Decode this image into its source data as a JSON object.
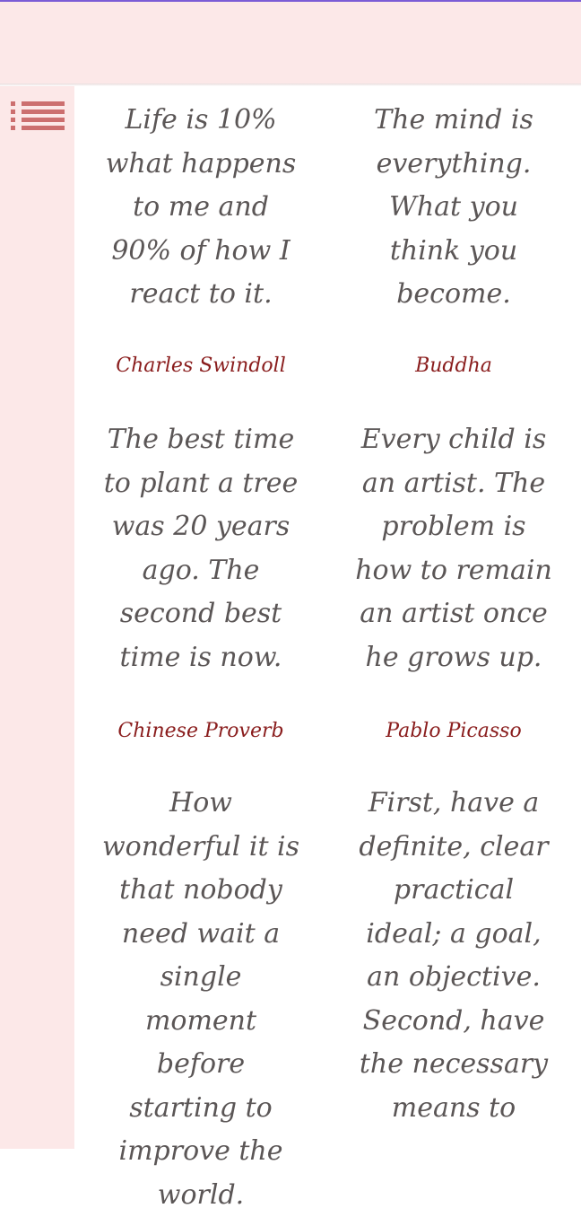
{
  "menu": {
    "icon": "list-icon"
  },
  "quotes": [
    {
      "text": "Life is 10% what happens to me and 90% of how I react to it.",
      "author": "Charles Swindoll"
    },
    {
      "text": "The mind is everything. What you think you become.",
      "author": "Buddha"
    },
    {
      "text": "The best time to plant a tree was 20 years ago. The second best time is now.",
      "author": "Chinese Proverb"
    },
    {
      "text": "Every child is an artist.  The problem is how to remain an artist once he grows up.",
      "author": "Pablo Picasso"
    },
    {
      "text": "How wonderful it is that nobody need wait a single moment before starting to improve the world.",
      "author": ""
    },
    {
      "text": "First, have a definite, clear practical ideal; a goal, an objective. Second, have the necessary means to",
      "author": ""
    }
  ],
  "colors": {
    "topbar": "#fce8e8",
    "sidebar": "#fce8e8",
    "accent": "#cc6f6f",
    "quote_text": "#5b5656",
    "author_text": "#8a1d1d"
  }
}
